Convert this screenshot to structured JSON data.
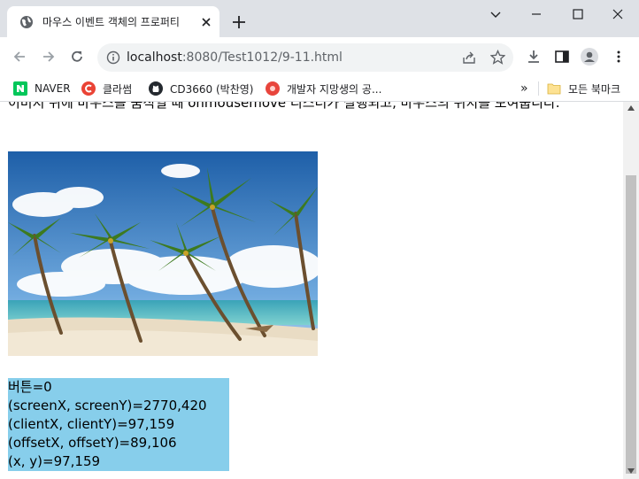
{
  "tab": {
    "title": "마우스 이벤트 객체의 프로퍼티"
  },
  "toolbar": {
    "url_host": "localhost",
    "url_rest": ":8080/Test1012/9-11.html"
  },
  "bookmarks": {
    "items": [
      {
        "label": "NAVER",
        "icon": "naver-icon",
        "color": "#03c75a"
      },
      {
        "label": "클라썸",
        "icon": "classum-icon",
        "color": "#ea4335"
      },
      {
        "label": "CD3660 (박찬영)",
        "icon": "github-icon",
        "color": "#24292f"
      },
      {
        "label": "개발자 지망생의 공...",
        "icon": "blog-icon",
        "color": "#e8453c"
      }
    ],
    "more": "»",
    "all_bookmarks": "모든 북마크"
  },
  "page": {
    "paragraph": "이미지 위에 마우스를 움직일 때 onmousemove 리스너가 실행되고, 마우스의 위치를 보여줍니다.",
    "info": {
      "button": "버튼=0",
      "screen": "(screenX, screenY)=2770,420",
      "client": "(clientX, clientY)=97,159",
      "offset": "(offsetX, offsetY)=89,106",
      "xy": "(x, y)=97,159"
    }
  },
  "colors": {
    "infobox_bg": "#87ceeb",
    "tabstrip_bg": "#dee1e6"
  }
}
